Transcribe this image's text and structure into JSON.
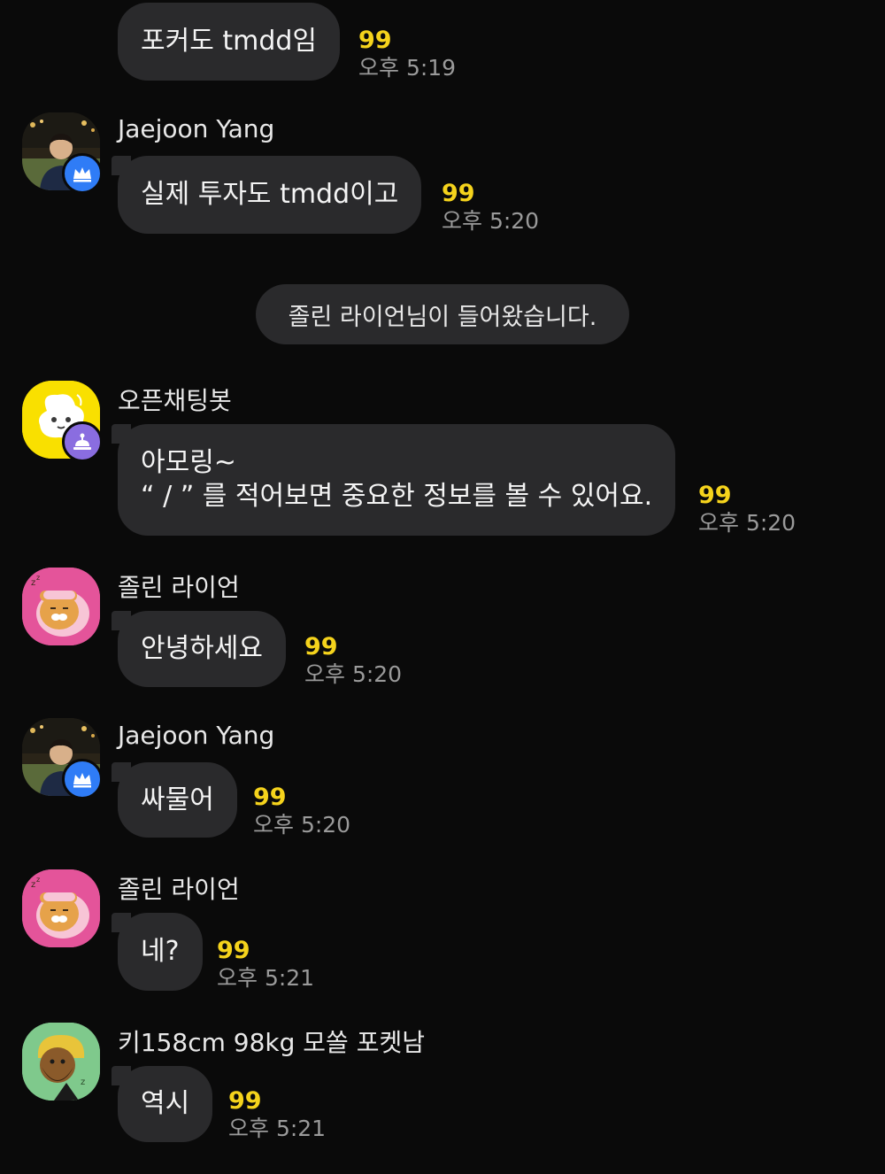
{
  "messages": [
    {
      "text": "포커도 tmdd임",
      "count": "99",
      "time": "오후 5:19"
    },
    {
      "sender": "Jaejoon Yang",
      "text": "실제 투자도 tmdd이고",
      "count": "99",
      "time": "오후 5:20"
    },
    {
      "sender": "오픈채팅봇",
      "line1": "아모링~",
      "line2": "“ / ” 를 적어보면 중요한 정보를 볼 수 있어요.",
      "count": "99",
      "time": "오후 5:20"
    },
    {
      "sender": "졸린 라이언",
      "text": "안녕하세요",
      "count": "99",
      "time": "오후 5:20"
    },
    {
      "sender": "Jaejoon Yang",
      "text": "싸물어",
      "count": "99",
      "time": "오후 5:20"
    },
    {
      "sender": "졸린 라이언",
      "text": "네?",
      "count": "99",
      "time": "오후 5:21"
    },
    {
      "sender": "키158cm 98kg 모쏠 포켓남",
      "text": "역시",
      "count": "99",
      "time": "오후 5:21"
    }
  ],
  "system_notice": "졸린 라이언님이 들어왔습니다.",
  "colors": {
    "background": "#0a0a0a",
    "bubble": "#2a2a2c",
    "unread_count": "#f5d31c",
    "timestamp": "#9a9a9a"
  },
  "icons": {
    "owner_badge": "crown-icon",
    "bot_badge": "robot-icon",
    "bot_avatar": "chatbot-avatar",
    "ryan_avatar": "sleepy-ryan-avatar",
    "member_avatar": "bearded-character-avatar"
  }
}
